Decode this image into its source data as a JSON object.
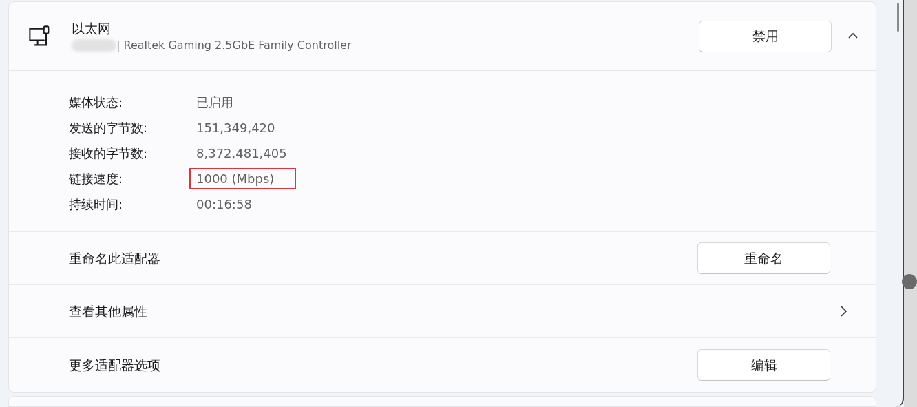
{
  "adapter": {
    "title": "以太网",
    "description": "| Realtek Gaming 2.5GbE Family Controller",
    "name_redacted": true,
    "button": "禁用",
    "expanded": true
  },
  "properties": [
    {
      "label": "媒体状态:",
      "value": "已启用",
      "highlighted": false
    },
    {
      "label": "发送的字节数:",
      "value": "151,349,420",
      "highlighted": false
    },
    {
      "label": "接收的字节数:",
      "value": "8,372,481,405",
      "highlighted": false
    },
    {
      "label": "链接速度:",
      "value": "1000 (Mbps)",
      "highlighted": true
    },
    {
      "label": "持续时间:",
      "value": "00:16:58",
      "highlighted": false
    }
  ],
  "actions": [
    {
      "kind": "button",
      "label": "重命名此适配器",
      "button": "重命名"
    },
    {
      "kind": "link",
      "label": "查看其他属性"
    },
    {
      "kind": "button",
      "label": "更多适配器选项",
      "button": "编辑"
    }
  ]
}
